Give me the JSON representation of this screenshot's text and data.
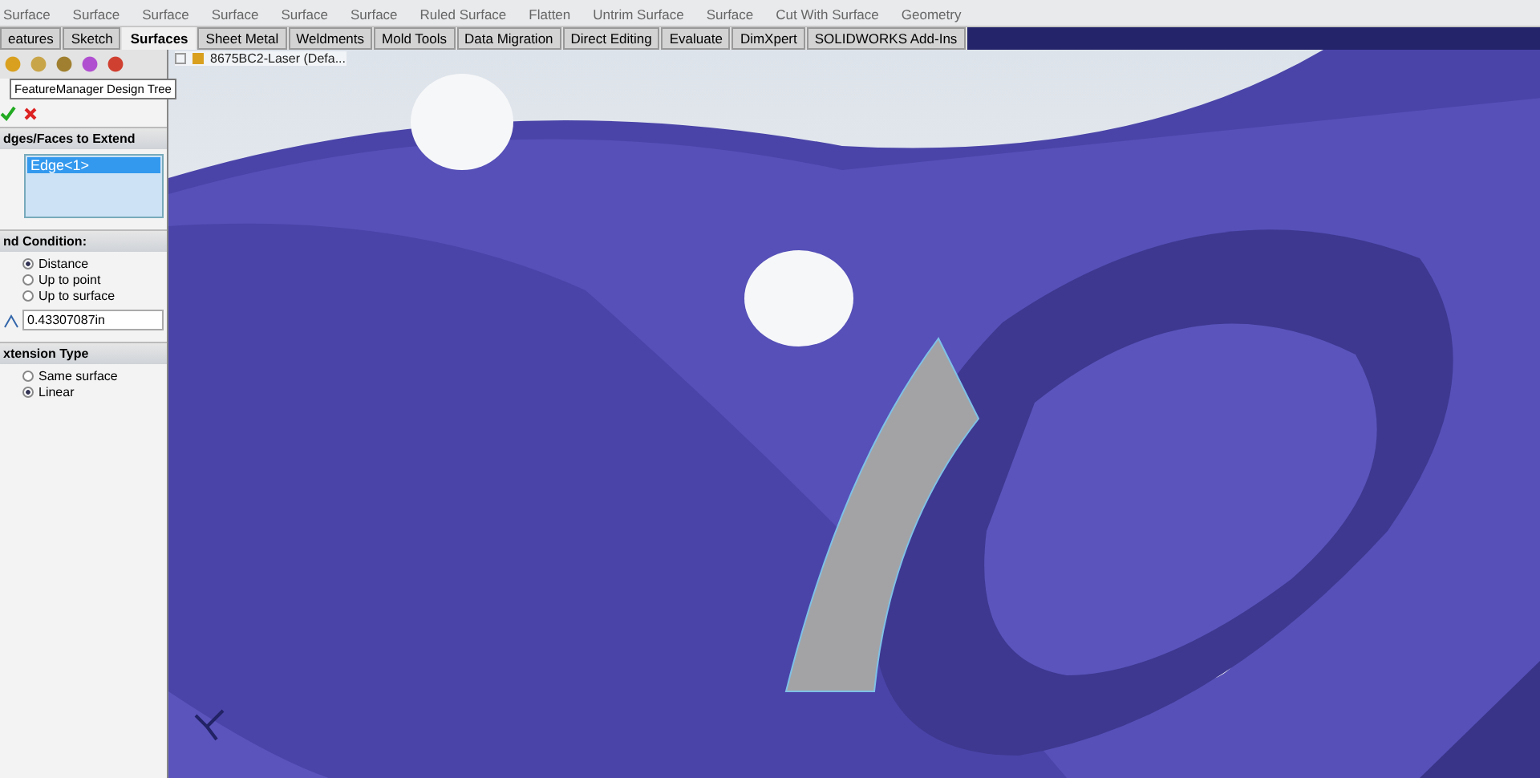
{
  "ribbon": {
    "items": [
      "Surface",
      "Surface",
      "Surface",
      "Surface",
      "Surface",
      "Surface",
      "Ruled Surface",
      "Flatten",
      "Untrim Surface",
      "Surface",
      "Cut With Surface",
      "Geometry"
    ]
  },
  "tabs": [
    {
      "label": "eatures",
      "selected": false
    },
    {
      "label": "Sketch",
      "selected": false
    },
    {
      "label": "Surfaces",
      "selected": true
    },
    {
      "label": "Sheet Metal",
      "selected": false
    },
    {
      "label": "Weldments",
      "selected": false
    },
    {
      "label": "Mold Tools",
      "selected": false
    },
    {
      "label": "Data Migration",
      "selected": false
    },
    {
      "label": "Direct Editing",
      "selected": false
    },
    {
      "label": "Evaluate",
      "selected": false
    },
    {
      "label": "DimXpert",
      "selected": false
    },
    {
      "label": "SOLIDWORKS Add-Ins",
      "selected": false
    }
  ],
  "property_manager": {
    "tooltip": "FeatureManager Design Tree",
    "sections": [
      {
        "kind": "list",
        "title": "dges/Faces to Extend",
        "items": [
          "Edge<1>"
        ]
      },
      {
        "kind": "radios",
        "title": "nd Condition:",
        "options": [
          {
            "label": "Distance",
            "selected": true
          },
          {
            "label": "Up to point",
            "selected": false
          },
          {
            "label": "Up to surface",
            "selected": false
          }
        ],
        "field": {
          "value": "0.43307087in"
        }
      },
      {
        "kind": "radios",
        "title": "xtension Type",
        "options": [
          {
            "label": "Same surface",
            "selected": false
          },
          {
            "label": "Linear",
            "selected": true
          }
        ]
      }
    ]
  },
  "viewport": {
    "tree_root": "8675BC2-Laser (Defa..."
  }
}
